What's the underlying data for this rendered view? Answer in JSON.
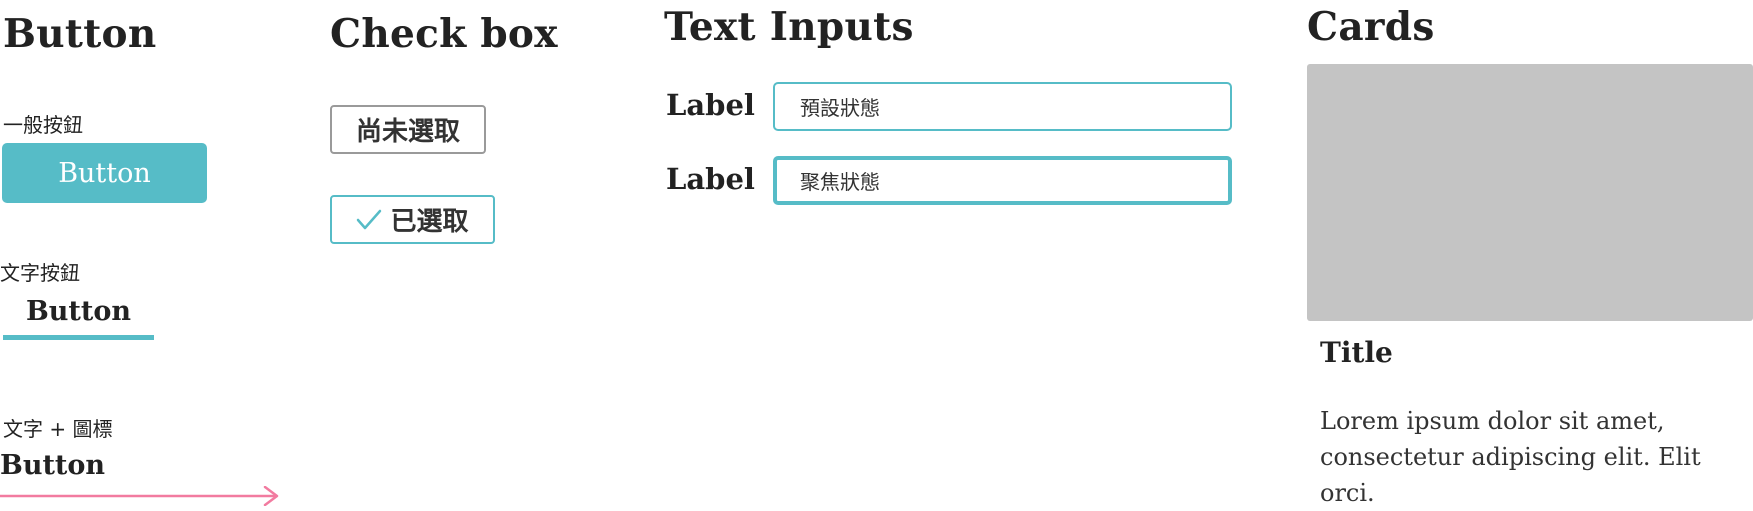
{
  "sections": {
    "button": "Button",
    "checkbox": "Check box",
    "text_inputs": "Text Inputs",
    "cards": "Cards"
  },
  "buttons": {
    "primary_caption": "一般按鈕",
    "primary_label": "Button",
    "text_caption": "文字按鈕",
    "text_label": "Button",
    "icon_caption": "文字 + 圖標",
    "icon_label": "Button",
    "icon": "arrow-right-icon"
  },
  "checkboxes": {
    "unchecked_label": "尚未選取",
    "checked_label": "已選取",
    "checked_icon": "checkmark-icon"
  },
  "inputs": [
    {
      "label": "Label",
      "value": "預設狀態",
      "state": "default"
    },
    {
      "label": "Label",
      "value": "聚焦狀態",
      "state": "focus"
    }
  ],
  "card": {
    "title": "Title",
    "body": "Lorem ipsum dolor sit amet, consectetur adipiscing elit. Elit orci."
  },
  "colors": {
    "accent": "#56bcc7",
    "arrow": "#f27ba0",
    "card_placeholder": "#c4c4c4",
    "checkbox_border": "#9a9a9a"
  }
}
